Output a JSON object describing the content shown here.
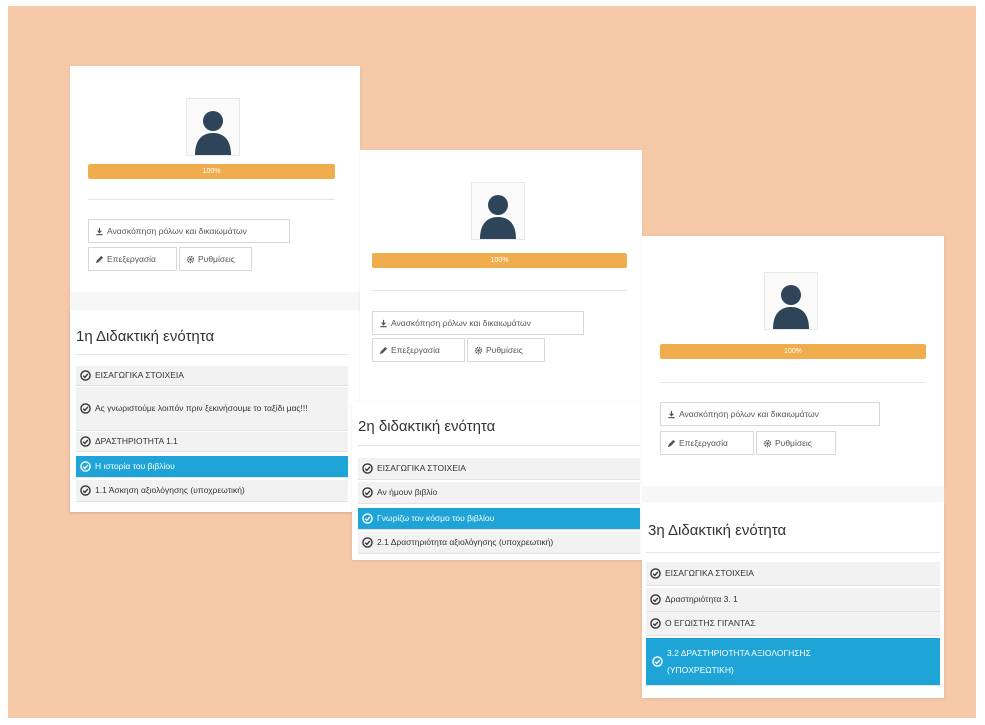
{
  "colors": {
    "background": "#f5c8a7",
    "progress": "#f0ad4e",
    "active_lesson": "#1ea4d6",
    "avatar_figure": "#2d4459"
  },
  "icons": {
    "avatar": "user-silhouette-icon",
    "download": "download-icon",
    "edit": "pencil-icon",
    "settings": "gear-icon",
    "completed": "check-circle-icon"
  },
  "cards": [
    {
      "progress_label": "100%",
      "progress_value": 100,
      "roles_button": "Ανασκόπηση ρόλων και δικαιωμάτων",
      "edit_button": "Επεξεργασία",
      "settings_button": "Ρυθμίσεις",
      "unit_title": "1η Διδακτική ενότητα",
      "lessons": [
        {
          "label": "ΕΙΣΑΓΩΓΙΚΑ ΣΤΟΙΧΕΙΑ",
          "active": false
        },
        {
          "label": "Ας γνωριστούμε λοιπόν πριν ξεκινήσουμε το ταξίδι μας!!!",
          "active": false
        },
        {
          "label": "ΔΡΑΣΤΗΡΙΟΤΗΤΑ 1.1",
          "active": false
        },
        {
          "label": "Η ιστορία του βιβλίου",
          "active": true
        },
        {
          "label": "1.1 Άσκηση αξιολόγησης (υποχρεωτική)",
          "active": false
        }
      ]
    },
    {
      "progress_label": "100%",
      "progress_value": 100,
      "roles_button": "Ανασκόπηση ρόλων και δικαιωμάτων",
      "edit_button": "Επεξεργασία",
      "settings_button": "Ρυθμίσεις",
      "unit_title": "2η διδακτική ενότητα",
      "lessons": [
        {
          "label": "ΕΙΣΑΓΩΓΙΚΑ ΣΤΟΙΧΕΙΑ",
          "active": false
        },
        {
          "label": "Αν ήμουν βιβλίο",
          "active": false
        },
        {
          "label": "Γνωρίζω τον κόσμο του βιβλίου",
          "active": true
        },
        {
          "label": "2.1 Δραστηριότητα αξιολόγησης (υποχρεωτική)",
          "active": false
        }
      ]
    },
    {
      "progress_label": "100%",
      "progress_value": 100,
      "roles_button": "Ανασκόπηση ρόλων και δικαιωμάτων",
      "edit_button": "Επεξεργασία",
      "settings_button": "Ρυθμίσεις",
      "unit_title": "3η Διδακτική ενότητα",
      "lessons": [
        {
          "label": "ΕΙΣΑΓΩΓΙΚΑ ΣΤΟΙΧΕΙΑ",
          "active": false
        },
        {
          "label": "Δραστηριότητα 3. 1",
          "active": false
        },
        {
          "label": "Ο ΕΓΩΙΣΤΗΣ ΓΙΓΑΝΤΑΣ",
          "active": false
        },
        {
          "label": "3.2 ΔΡΑΣΤΗΡΙΟΤΗΤΑ ΑΞΙΟΛΟΓΗΣΗΣ (ΥΠΟΧΡΕΩΤΙΚΗ)",
          "active": true
        }
      ]
    }
  ]
}
